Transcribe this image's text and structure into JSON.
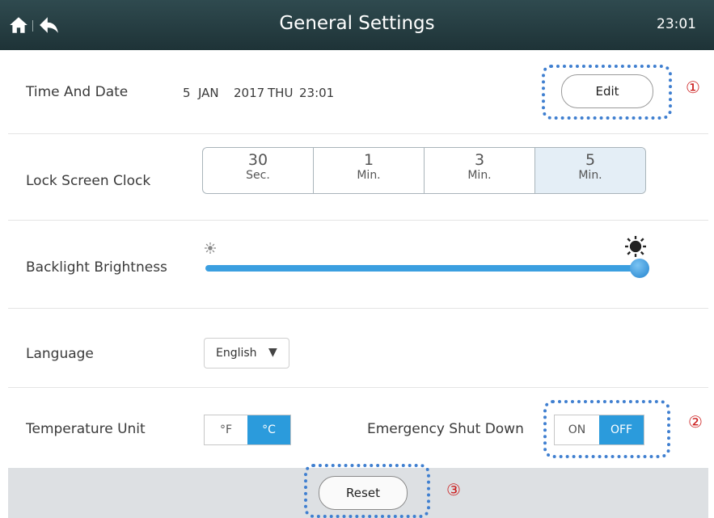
{
  "header": {
    "title": "General Settings",
    "time": "23:01",
    "home_icon": "home-icon",
    "back_icon": "back-arrow-icon"
  },
  "time_date": {
    "label": "Time And Date",
    "day": "5",
    "month": "JAN",
    "year": "2017",
    "weekday": "THU",
    "time": "23:01",
    "edit_label": "Edit",
    "marker": "①"
  },
  "lock_screen": {
    "label": "Lock Screen Clock",
    "options": [
      {
        "num": "30",
        "unit": "Sec."
      },
      {
        "num": "1",
        "unit": "Min."
      },
      {
        "num": "3",
        "unit": "Min."
      },
      {
        "num": "5",
        "unit": "Min."
      }
    ],
    "selected": "5 Min."
  },
  "backlight": {
    "label": "Backlight Brightness",
    "level": 1.0,
    "low_icon": "sun-small-icon",
    "high_icon": "sun-large-icon"
  },
  "language": {
    "label": "Language",
    "value": "English",
    "arrow": "▼"
  },
  "temperature": {
    "label": "Temperature Unit",
    "options": [
      "°F",
      "°C"
    ],
    "selected": "°C"
  },
  "emergency": {
    "label": "Emergency Shut Down",
    "options": [
      "ON",
      "OFF"
    ],
    "selected": "OFF",
    "marker": "②"
  },
  "reset": {
    "label": "Reset",
    "marker": "③"
  },
  "colors": {
    "accent": "#2b9bdc",
    "header": "#263d41",
    "highlight": "#3f7fd0",
    "marker": "#cc1f1f"
  }
}
